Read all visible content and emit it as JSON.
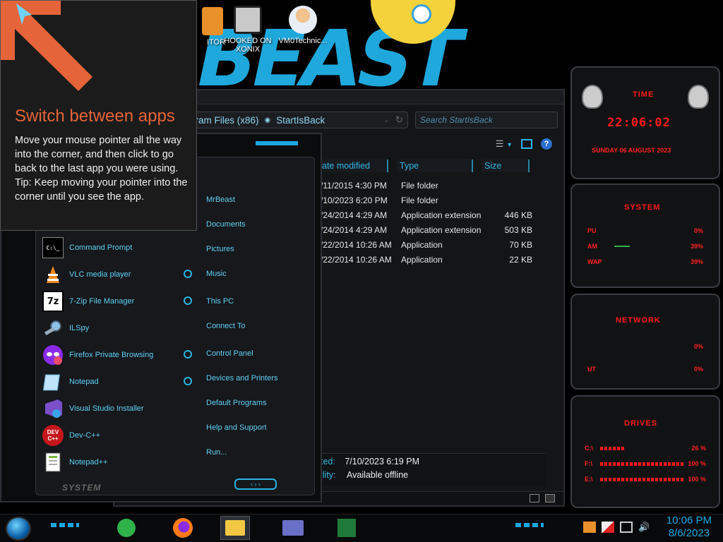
{
  "desktop": {
    "wallpaper_text": "BEAST",
    "icons": [
      {
        "label": "ITOR"
      },
      {
        "label": "HOOKED ON XONIX"
      },
      {
        "label": "VM0Technic..."
      }
    ]
  },
  "tip": {
    "title": "Switch between apps",
    "body": "Move your mouse pointer all the way into the corner, and then click to go back to the last app you were using.",
    "tip": "Tip: Keep moving your pointer into the corner until you see the app."
  },
  "explorer": {
    "breadcrumb": {
      "part1": "gram Files (x86)",
      "part2": "StartIsBack"
    },
    "search_placeholder": "Search StartIsBack",
    "columns": {
      "date": "ate modified",
      "type": "Type",
      "size": "Size"
    },
    "rows": [
      {
        "date": "/11/2015 4:30 PM",
        "type": "File folder",
        "size": ""
      },
      {
        "date": "/10/2023 6:20 PM",
        "type": "File folder",
        "size": ""
      },
      {
        "date": "/24/2014 4:29 AM",
        "type": "Application extension",
        "size": "446 KB"
      },
      {
        "date": "/24/2014 4:29 AM",
        "type": "Application extension",
        "size": "503 KB"
      },
      {
        "date": "/22/2014 10:26 AM",
        "type": "Application",
        "size": "70 KB"
      },
      {
        "date": "/22/2014 10:26 AM",
        "type": "Application",
        "size": "22 KB"
      }
    ],
    "details": {
      "label1": "ted:",
      "value1": "7/10/2023 6:19 PM",
      "label2": "ility:",
      "value2": "Available offline"
    }
  },
  "startmenu": {
    "programs": [
      {
        "label": "Command Prompt",
        "icon": "C:\\_"
      },
      {
        "label": "VLC media player",
        "icon": "vlc"
      },
      {
        "label": "7-Zip File Manager",
        "icon": "7z"
      },
      {
        "label": "ILSpy",
        "icon": "ilspy"
      },
      {
        "label": "Firefox Private Browsing",
        "icon": "firefox-private"
      },
      {
        "label": "Notepad",
        "icon": "notepad"
      },
      {
        "label": "Visual Studio Installer",
        "icon": "vs"
      },
      {
        "label": "Dev-C++",
        "icon": "DEV C++"
      },
      {
        "label": "Notepad++",
        "icon": "notepad++"
      }
    ],
    "places": [
      "MrBeast",
      "Documents",
      "Pictures",
      "Music",
      "This PC",
      "Connect To",
      "Control Panel",
      "Devices and Printers",
      "Default Programs",
      "Help and Support",
      "Run..."
    ],
    "footer": "SYSTEM"
  },
  "gadgets": {
    "time": {
      "title": "TIME",
      "clock": "22:06:02",
      "date": "SUNDAY 06 AUGUST 2023"
    },
    "system": {
      "title": "SYSTEM",
      "rows": [
        {
          "k": "PU",
          "v": "0%"
        },
        {
          "k": "AM",
          "v": "39%"
        },
        {
          "k": "WAP",
          "v": "39%"
        }
      ]
    },
    "network": {
      "title": "NETWORK",
      "rows": [
        {
          "k": "",
          "v": "0%"
        },
        {
          "k": "UT",
          "v": "0%"
        }
      ]
    },
    "drives": {
      "title": "DRIVES",
      "rows": [
        {
          "k": "C:\\",
          "v": "26 %"
        },
        {
          "k": "F:\\",
          "v": "100 %"
        },
        {
          "k": "E:\\",
          "v": "100 %"
        }
      ]
    }
  },
  "taskbar": {
    "time": "10:06 PM",
    "date": "8/6/2023"
  }
}
